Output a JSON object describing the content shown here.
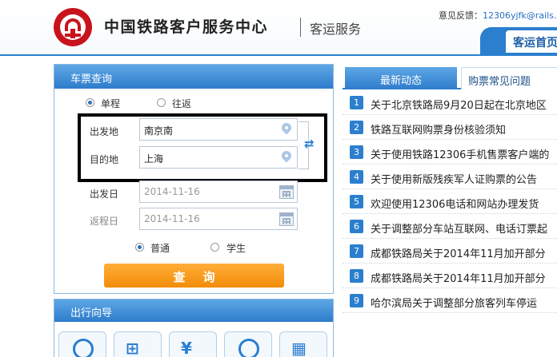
{
  "header": {
    "site_title": "中国铁路客户服务中心",
    "site_subtitle": "客运服务",
    "feedback_label": "意见反馈：",
    "feedback_email": "12306yjfk@rails.",
    "nav_tab": "客运首页"
  },
  "ticket_query": {
    "title": "车票查询",
    "trip_types": [
      "单程",
      "往返"
    ],
    "trip_type_selected": "单程",
    "from_label": "出发地",
    "from_value": "南京南",
    "to_label": "目的地",
    "to_value": "上海",
    "depart_label": "出发日",
    "depart_value": "2014-11-16",
    "return_label": "返程日",
    "return_value": "2014-11-16",
    "passenger_types": [
      "普通",
      "学生"
    ],
    "passenger_type_selected": "普通",
    "query_button": "查询"
  },
  "guide": {
    "title": "出行向导"
  },
  "news": {
    "tabs": [
      "最新动态",
      "购票常见问题"
    ],
    "active_tab": "最新动态",
    "items": [
      {
        "num": "1",
        "text": "关于北京铁路局9月20日起在北京地区"
      },
      {
        "num": "2",
        "text": "铁路互联网购票身份核验须知"
      },
      {
        "num": "3",
        "text": "关于使用铁路12306手机售票客户端的"
      },
      {
        "num": "4",
        "text": "关于使用新版残疾军人证购票的公告"
      },
      {
        "num": "5",
        "text": "欢迎使用12306电话和网站办理发货"
      },
      {
        "num": "6",
        "text": "关于调整部分车站互联网、电话订票起"
      },
      {
        "num": "7",
        "text": "成都铁路局关于2014年11月加开部分"
      },
      {
        "num": "8",
        "text": "成都铁路局关于2014年11月加开部分"
      },
      {
        "num": "9",
        "text": "哈尔滨局关于调整部分旅客列车停运"
      }
    ]
  },
  "colors": {
    "brand_red": "#c8131c",
    "primary_blue": "#2c7fce",
    "button_orange": "#f38c08"
  }
}
